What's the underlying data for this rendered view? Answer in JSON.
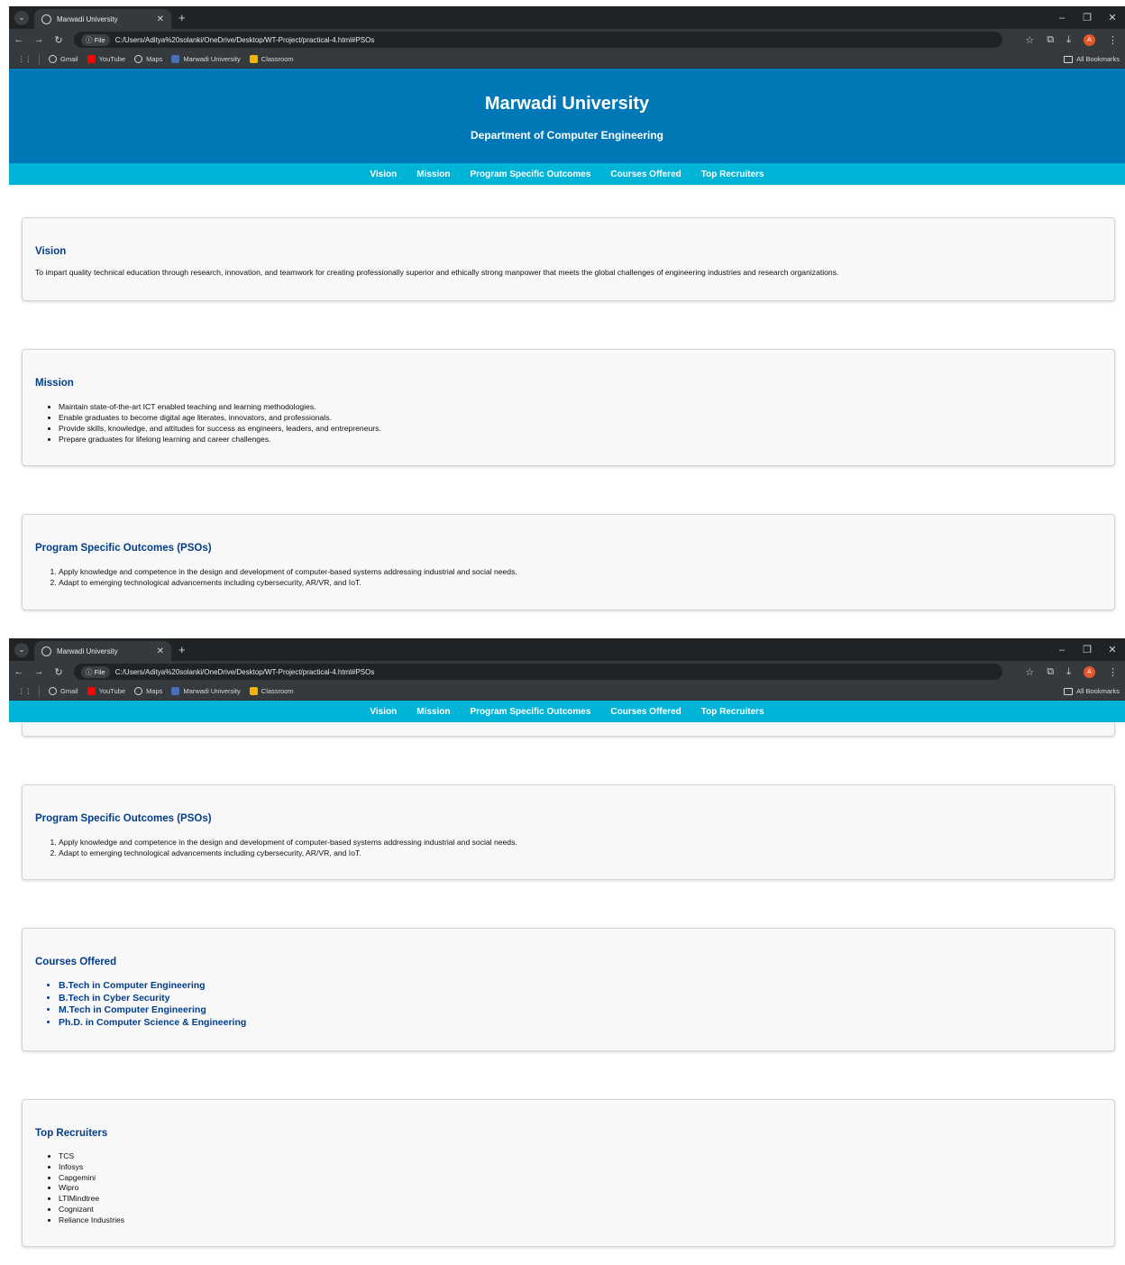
{
  "browser": {
    "tab_title": "Marwadi University",
    "url_badge": "File",
    "url": "C:/Users/Aditya%20solanki/OneDrive/Desktop/WT-Project/practical-4.html#PSOs",
    "avatar_letter": "A",
    "bookmarks": [
      "Gmail",
      "YouTube",
      "Maps",
      "Marwadi University",
      "Classroom"
    ],
    "all_bookmarks": "All Bookmarks"
  },
  "header": {
    "title": "Marwadi University",
    "subtitle": "Department of Computer Engineering"
  },
  "nav": [
    "Vision",
    "Mission",
    "Program Specific Outcomes",
    "Courses Offered",
    "Top Recruiters"
  ],
  "vision": {
    "heading": "Vision",
    "text": "To impart quality technical education through research, innovation, and teamwork for creating professionally superior and ethically strong manpower that meets the global challenges of engineering industries and research organizations."
  },
  "mission": {
    "heading": "Mission",
    "items": [
      "Maintain state-of-the-art ICT enabled teaching and learning methodologies.",
      "Enable graduates to become digital age literates, innovators, and professionals.",
      "Provide skills, knowledge, and attitudes for success as engineers, leaders, and entrepreneurs.",
      "Prepare graduates for lifelong learning and career challenges."
    ]
  },
  "psos": {
    "heading": "Program Specific Outcomes (PSOs)",
    "items": [
      "Apply knowledge and competence in the design and development of computer-based systems addressing industrial and social needs.",
      "Adapt to emerging technological advancements including cybersecurity, AR/VR, and IoT."
    ]
  },
  "courses": {
    "heading": "Courses Offered",
    "items": [
      "B.Tech in Computer Engineering",
      "B.Tech in Cyber Security",
      "M.Tech in Computer Engineering",
      "Ph.D. in Computer Science & Engineering"
    ]
  },
  "recruiters": {
    "heading": "Top Recruiters",
    "items": [
      "TCS",
      "Infosys",
      "Capgemini",
      "Wipro",
      "LTIMindtree",
      "Cognizant",
      "Reliance Industries"
    ]
  }
}
